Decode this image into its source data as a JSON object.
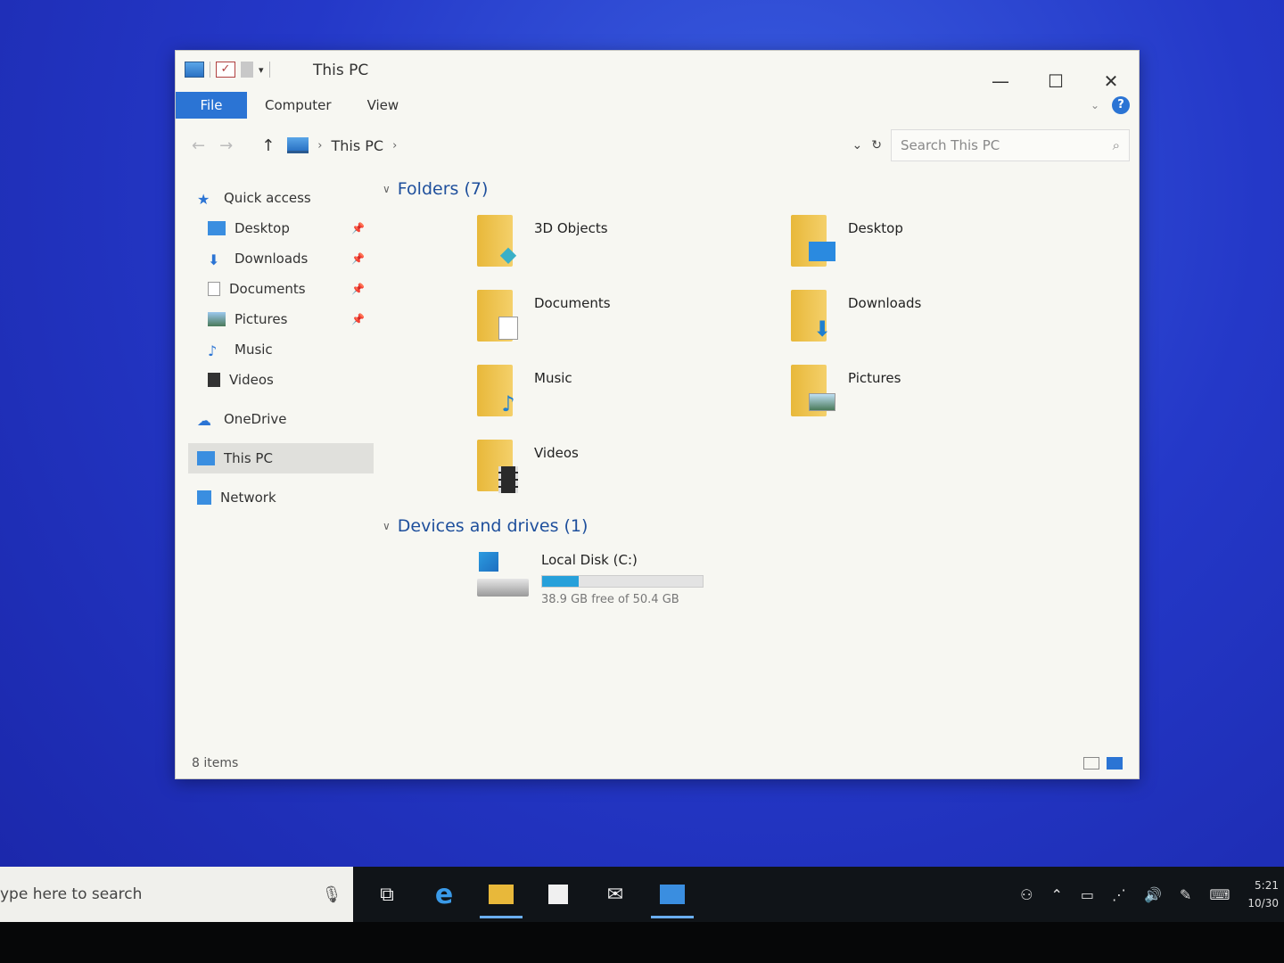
{
  "window": {
    "title": "This PC",
    "controls": {
      "minimize": "—",
      "maximize": "☐",
      "close": "✕"
    }
  },
  "ribbon": {
    "file": "File",
    "tabs": [
      "Computer",
      "View"
    ]
  },
  "address": {
    "back": "←",
    "forward": "→",
    "up": "↑",
    "location": "This PC",
    "sep": "›",
    "search_placeholder": "Search This PC"
  },
  "nav": {
    "quick_access": "Quick access",
    "items": [
      {
        "label": "Desktop",
        "pinned": true
      },
      {
        "label": "Downloads",
        "pinned": true
      },
      {
        "label": "Documents",
        "pinned": true
      },
      {
        "label": "Pictures",
        "pinned": true
      },
      {
        "label": "Music",
        "pinned": false
      },
      {
        "label": "Videos",
        "pinned": false
      }
    ],
    "onedrive": "OneDrive",
    "this_pc": "This PC",
    "network": "Network"
  },
  "content": {
    "folders_header": "Folders (7)",
    "folders": [
      "3D Objects",
      "Desktop",
      "Documents",
      "Downloads",
      "Music",
      "Pictures",
      "Videos"
    ],
    "drives_header": "Devices and drives (1)",
    "drive": {
      "name": "Local Disk (C:)",
      "free": "38.9 GB free of 50.4 GB",
      "used_fraction": 0.228
    }
  },
  "status": {
    "items": "8 items"
  },
  "taskbar": {
    "search_placeholder": "ype here to search",
    "time": "5:21",
    "date": "10/30"
  },
  "colors": {
    "accent": "#2b74d4",
    "folder": "#e8b83a",
    "desktop_bg": "#2438c8"
  }
}
